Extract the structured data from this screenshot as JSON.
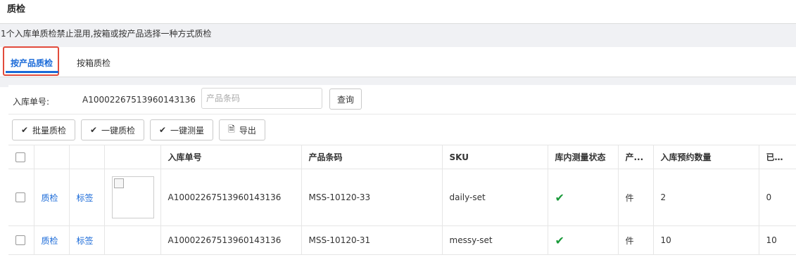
{
  "page_title": "质检",
  "notice": "1个入库单质检禁止混用,按箱或按产品选择一种方式质检",
  "tabs": [
    {
      "label": "按产品质检",
      "active": true
    },
    {
      "label": "按箱质检",
      "active": false
    }
  ],
  "search": {
    "order_label": "入库单号:",
    "order_value": "A10002267513960143136",
    "barcode_placeholder": "产品条码",
    "query_label": "查询"
  },
  "actions": {
    "batch_qc": "批量质检",
    "one_click_qc": "一键质检",
    "one_click_measure": "一键测量",
    "export": "导出"
  },
  "table": {
    "headers": {
      "order_no": "入库单号",
      "barcode": "产品条码",
      "sku": "SKU",
      "measure_status": "库内测量状态",
      "unit": "产...",
      "planned_qty": "入库预约数量",
      "arrived_qty": "已到合格"
    },
    "rows": [
      {
        "qc": "质检",
        "label": "标签",
        "order_no": "A10002267513960143136",
        "barcode": "MSS-10120-33",
        "sku": "daily-set",
        "measured": true,
        "unit": "件",
        "planned_qty": "2",
        "arrived_qty": "0"
      },
      {
        "qc": "质检",
        "label": "标签",
        "order_no": "A10002267513960143136",
        "barcode": "MSS-10120-31",
        "sku": "messy-set",
        "measured": true,
        "unit": "件",
        "planned_qty": "10",
        "arrived_qty": "10"
      }
    ]
  },
  "colors": {
    "accent": "#1a6ad8",
    "highlight": "#e24b3b",
    "success": "#1a9a3a"
  },
  "icons": {
    "check": "check-icon",
    "export": "export-file-icon"
  }
}
